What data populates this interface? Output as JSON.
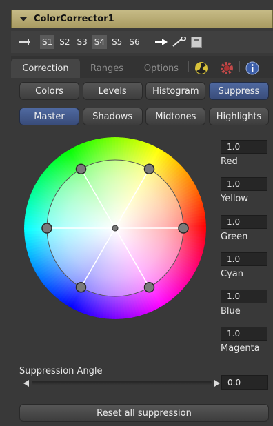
{
  "title": "ColorCorrector1",
  "slots": [
    {
      "label": "S1",
      "selected": true
    },
    {
      "label": "S2",
      "selected": false
    },
    {
      "label": "S3",
      "selected": false
    },
    {
      "label": "S4",
      "selected": true
    },
    {
      "label": "S5",
      "selected": false
    },
    {
      "label": "S6",
      "selected": false
    }
  ],
  "tabs": {
    "correction": "Correction",
    "ranges": "Ranges",
    "options": "Options"
  },
  "tools_row": {
    "colors": "Colors",
    "levels": "Levels",
    "histogram": "Histogram",
    "suppress": "Suppress"
  },
  "range_row": {
    "master": "Master",
    "shadows": "Shadows",
    "midtones": "Midtones",
    "highlights": "Highlights"
  },
  "values": [
    {
      "value": "1.0",
      "label": "Red"
    },
    {
      "value": "1.0",
      "label": "Yellow"
    },
    {
      "value": "1.0",
      "label": "Green"
    },
    {
      "value": "1.0",
      "label": "Cyan"
    },
    {
      "value": "1.0",
      "label": "Blue"
    },
    {
      "value": "1.0",
      "label": "Magenta"
    }
  ],
  "suppression_angle": {
    "label": "Suppression Angle",
    "value": "0.0"
  },
  "reset_label": "Reset all suppression",
  "colors": {
    "accent": "#394c7a",
    "title_bg": "#b8ac74",
    "panel": "#393939"
  },
  "icons": [
    "pin-icon",
    "arrow-icon",
    "picker-icon",
    "save-icon",
    "radiation-icon",
    "gear-icon",
    "info-icon"
  ]
}
